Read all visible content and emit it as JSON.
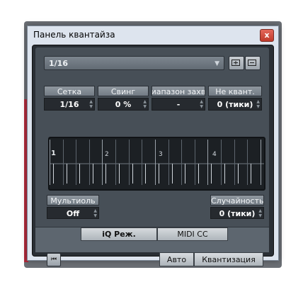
{
  "window": {
    "title": "Панель квантайза",
    "close_glyph": "x"
  },
  "preset": {
    "value": "1/16",
    "icons": [
      "store-preset-icon",
      "delete-preset-icon"
    ]
  },
  "params": [
    {
      "label": "Сетка",
      "value": "1/16"
    },
    {
      "label": "Свинг",
      "value": "0 %"
    },
    {
      "label": "Диапазон захвата",
      "value": "-"
    },
    {
      "label": "Не квант.",
      "value": "0 (тики)"
    }
  ],
  "grid": {
    "bar_labels": [
      "1",
      "2",
      "3",
      "4"
    ]
  },
  "tuplet": {
    "label": "Мультиоль",
    "value": "Off"
  },
  "random": {
    "label": "Случайность",
    "value": "0 (тики)"
  },
  "modes": {
    "iq_label": "iQ Реж.",
    "midi_cc_label": "MIDI CC"
  },
  "actions": {
    "auto_label": "Авто",
    "quantize_label": "Квантизация",
    "reset_icon": "skip-back-icon"
  },
  "colors": {
    "panel_bg": "#474f57",
    "title_close": "#c9483a"
  }
}
